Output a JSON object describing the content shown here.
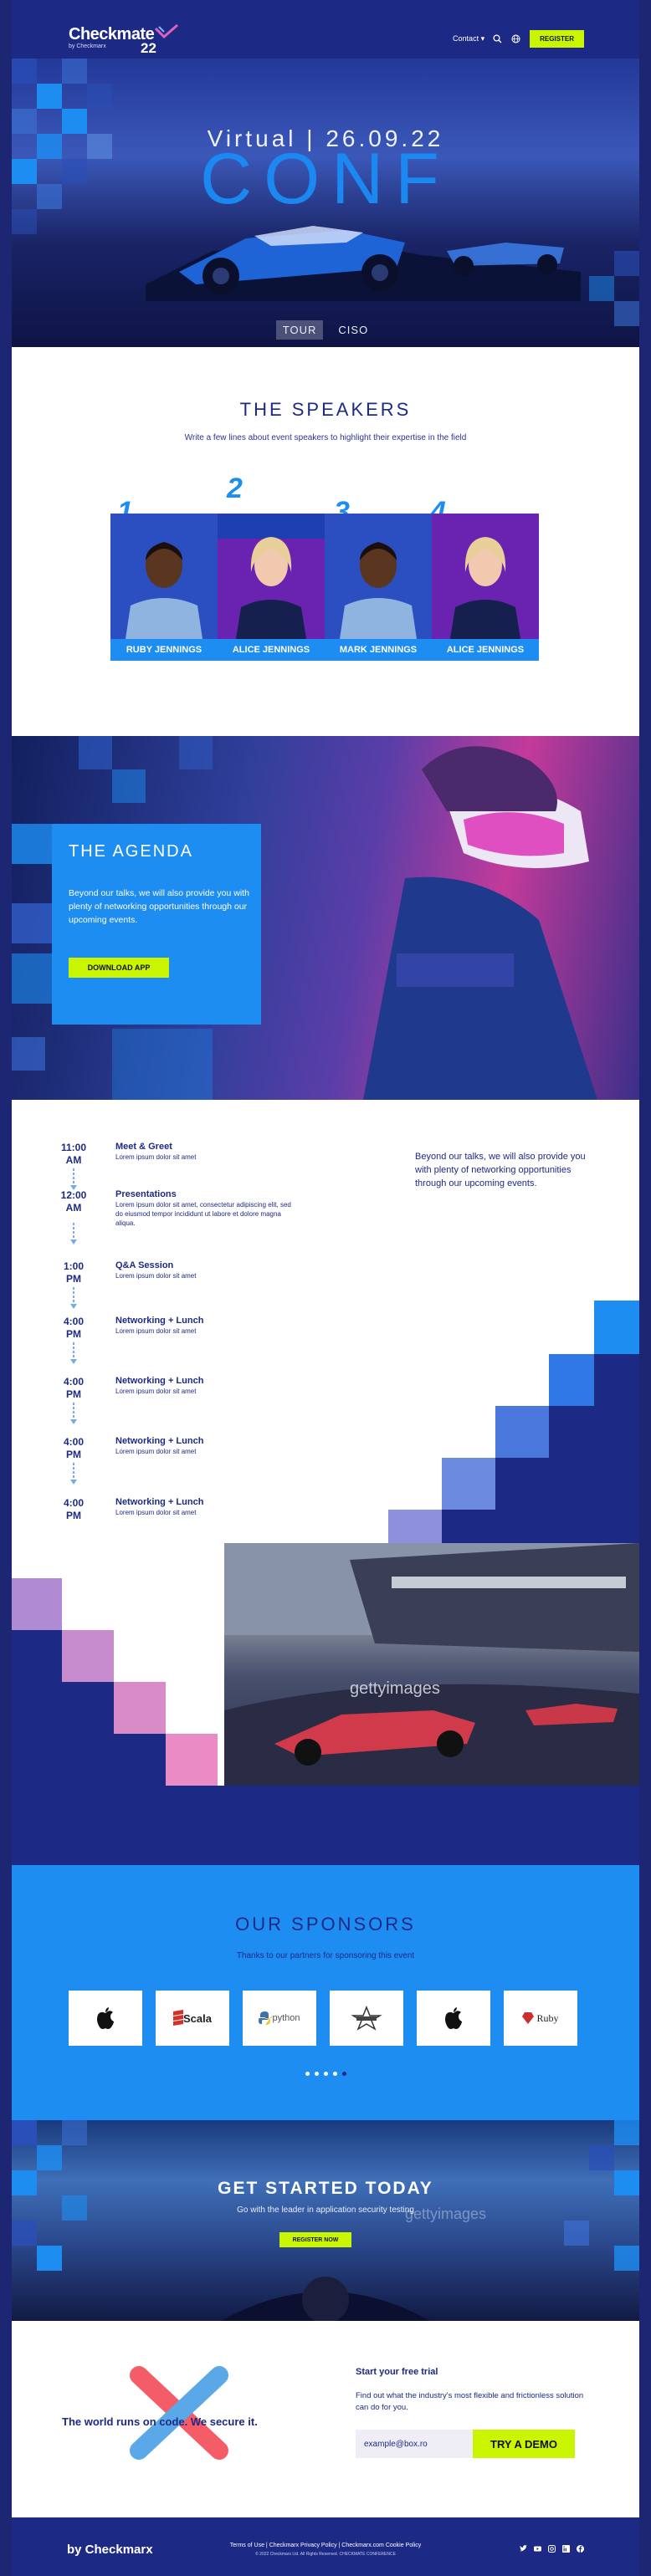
{
  "header": {
    "logo_text": "Checkmate",
    "logo_sub": "by Checkmarx",
    "logo_year": "22",
    "nav_contact": "Contact ▾",
    "register_label": "REGISTER"
  },
  "hero": {
    "subtitle": "Virtual | 26.09.22",
    "title": "CONF",
    "tabs": [
      {
        "label": "TOUR"
      },
      {
        "label": "CISO"
      }
    ]
  },
  "speakers": {
    "title": "THE SPEAKERS",
    "subtitle": "Write a few lines about event speakers to highlight their expertise in the field",
    "items": [
      {
        "number": "1",
        "name": "RUBY JENNINGS"
      },
      {
        "number": "2",
        "name": "ALICE JENNINGS"
      },
      {
        "number": "3",
        "name": "MARK JENNINGS"
      },
      {
        "number": "4",
        "name": "ALICE JENNINGS"
      }
    ]
  },
  "agenda": {
    "title": "THE AGENDA",
    "body": "Beyond our talks, we will also provide you with plenty of networking opportunities through our upcoming events.",
    "button_label": "DOWNLOAD APP"
  },
  "schedule": {
    "note": "Beyond our talks, we will also provide you with plenty of networking opportunities through our upcoming events.",
    "items": [
      {
        "time": "11:00",
        "period": "AM",
        "title": "Meet & Greet",
        "desc": "Lorem ipsum dolor sit amet"
      },
      {
        "time": "12:00",
        "period": "AM",
        "title": "Presentations",
        "desc": "Lorem ipsum dolor sit amet, consectetur adipiscing elit, sed do eiusmod tempor incididunt ut labore et dolore magna aliqua."
      },
      {
        "time": "1:00",
        "period": "PM",
        "title": "Q&A Session",
        "desc": "Lorem ipsum dolor sit amet"
      },
      {
        "time": "4:00",
        "period": "PM",
        "title": "Networking + Lunch",
        "desc": "Lorem ipsum dolor sit amet"
      },
      {
        "time": "4:00",
        "period": "PM",
        "title": "Networking + Lunch",
        "desc": "Lorem ipsum dolor sit amet"
      },
      {
        "time": "4:00",
        "period": "PM",
        "title": "Networking + Lunch",
        "desc": "Lorem ipsum dolor sit amet"
      },
      {
        "time": "4:00",
        "period": "PM",
        "title": "Networking + Lunch",
        "desc": "Lorem ipsum dolor sit amet"
      }
    ]
  },
  "sponsors": {
    "title": "OUR SPONSORS",
    "subtitle": "Thanks to our partners for sponsoring this event",
    "logos": [
      {
        "icon": "apple-logo-icon",
        "label": ""
      },
      {
        "icon": "scala-logo-icon",
        "label": "Scala"
      },
      {
        "icon": "python-logo-icon",
        "label": "python"
      },
      {
        "icon": "star-logo-icon",
        "label": ""
      },
      {
        "icon": "apple-logo-icon",
        "label": ""
      },
      {
        "icon": "ruby-logo-icon",
        "label": "Ruby"
      }
    ]
  },
  "getstarted": {
    "title": "GET STARTED TODAY",
    "subtitle": "Go with the leader in application security testing",
    "button_label": "REGISTER NOW",
    "watermark": "gettyimages"
  },
  "trial": {
    "tagline": "The world runs on code. We secure it.",
    "heading": "Start your free trial",
    "body": "Find out what the industry's most flexible and frictionless solution can do for you.",
    "email_value": "example@box.ro",
    "button_label": "TRY A DEMO"
  },
  "footer": {
    "logo": "by Checkmarx",
    "links": "Terms of Use | Checkmarx Privacy Policy | Checkmarx.com Cookie Policy",
    "copyright": "© 2022 Checkmarx Ltd. All Rights Reserved. CHECKMATE CONFERENCE",
    "social": [
      "twitter-icon",
      "youtube-icon",
      "instagram-icon",
      "linkedin-icon",
      "facebook-icon"
    ]
  },
  "colors": {
    "navy": "#1d2a85",
    "accent_blue": "#1e8df2",
    "lime": "#c9f500",
    "pink": "#e98bc4",
    "violet": "#b18ad4"
  }
}
